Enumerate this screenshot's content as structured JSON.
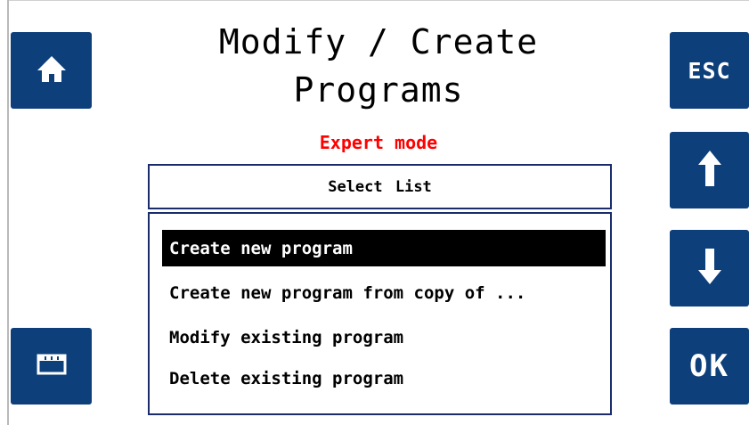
{
  "title_line1": "Modify / Create",
  "title_line2": "Programs",
  "mode_label": "Expert mode",
  "list_header": "Select List",
  "list_items": [
    {
      "label": "Create new program",
      "selected": true
    },
    {
      "label": "Create new program from copy of ..."
    },
    {
      "label": "Modify existing program"
    },
    {
      "label": "Delete existing program"
    }
  ],
  "buttons": {
    "home_icon": "home-icon",
    "menu_icon": "window-icon",
    "esc_label": "ESC",
    "up_icon": "arrow-up-icon",
    "down_icon": "arrow-down-icon",
    "ok_label": "OK"
  },
  "colors": {
    "button_bg": "#0d3f7a",
    "mode_text": "#ff0000",
    "box_border": "#1a2c6b",
    "selected_bg": "#000000"
  }
}
